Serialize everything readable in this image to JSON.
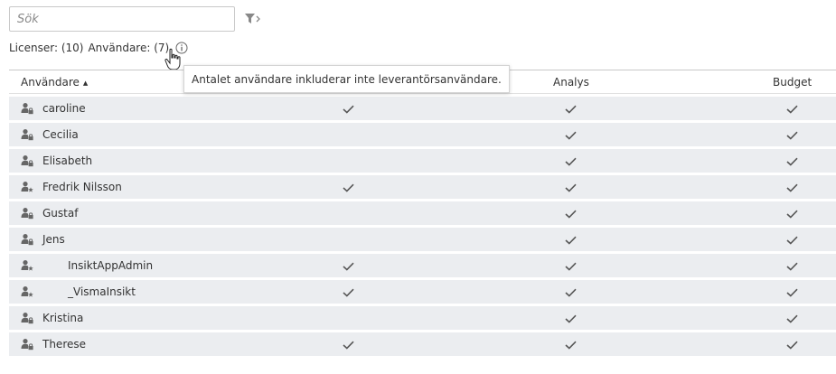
{
  "search": {
    "placeholder": "Sök",
    "value": ""
  },
  "license_info": {
    "licenses_label": "Licenser: (10)",
    "users_label": "Användare: (7)",
    "tooltip": "Antalet användare inkluderar inte leverantörsanvändare."
  },
  "table": {
    "columns": {
      "user": "Användare",
      "analys": "Analys",
      "budget": "Budget"
    },
    "sort_indicator": "▲",
    "rows": [
      {
        "name": "caroline",
        "icon": "user-lock-icon",
        "indent": false,
        "col1": true,
        "analys": true,
        "budget": true
      },
      {
        "name": "Cecilia",
        "icon": "user-lock-icon",
        "indent": false,
        "col1": false,
        "analys": true,
        "budget": true
      },
      {
        "name": "Elisabeth",
        "icon": "user-lock-icon",
        "indent": false,
        "col1": false,
        "analys": true,
        "budget": true
      },
      {
        "name": "Fredrik Nilsson",
        "icon": "user-star-icon",
        "indent": false,
        "col1": true,
        "analys": true,
        "budget": true
      },
      {
        "name": "Gustaf",
        "icon": "user-lock-icon",
        "indent": false,
        "col1": false,
        "analys": true,
        "budget": true
      },
      {
        "name": "Jens",
        "icon": "user-lock-icon",
        "indent": false,
        "col1": false,
        "analys": true,
        "budget": true
      },
      {
        "name": "InsiktAppAdmin",
        "icon": "user-star-icon",
        "indent": true,
        "col1": true,
        "analys": true,
        "budget": true
      },
      {
        "name": "_VismaInsikt",
        "icon": "user-star-icon",
        "indent": true,
        "col1": true,
        "analys": true,
        "budget": true
      },
      {
        "name": "Kristina",
        "icon": "user-lock-icon",
        "indent": false,
        "col1": false,
        "analys": true,
        "budget": true
      },
      {
        "name": "Therese",
        "icon": "user-lock-icon",
        "indent": false,
        "col1": true,
        "analys": true,
        "budget": true
      }
    ]
  }
}
